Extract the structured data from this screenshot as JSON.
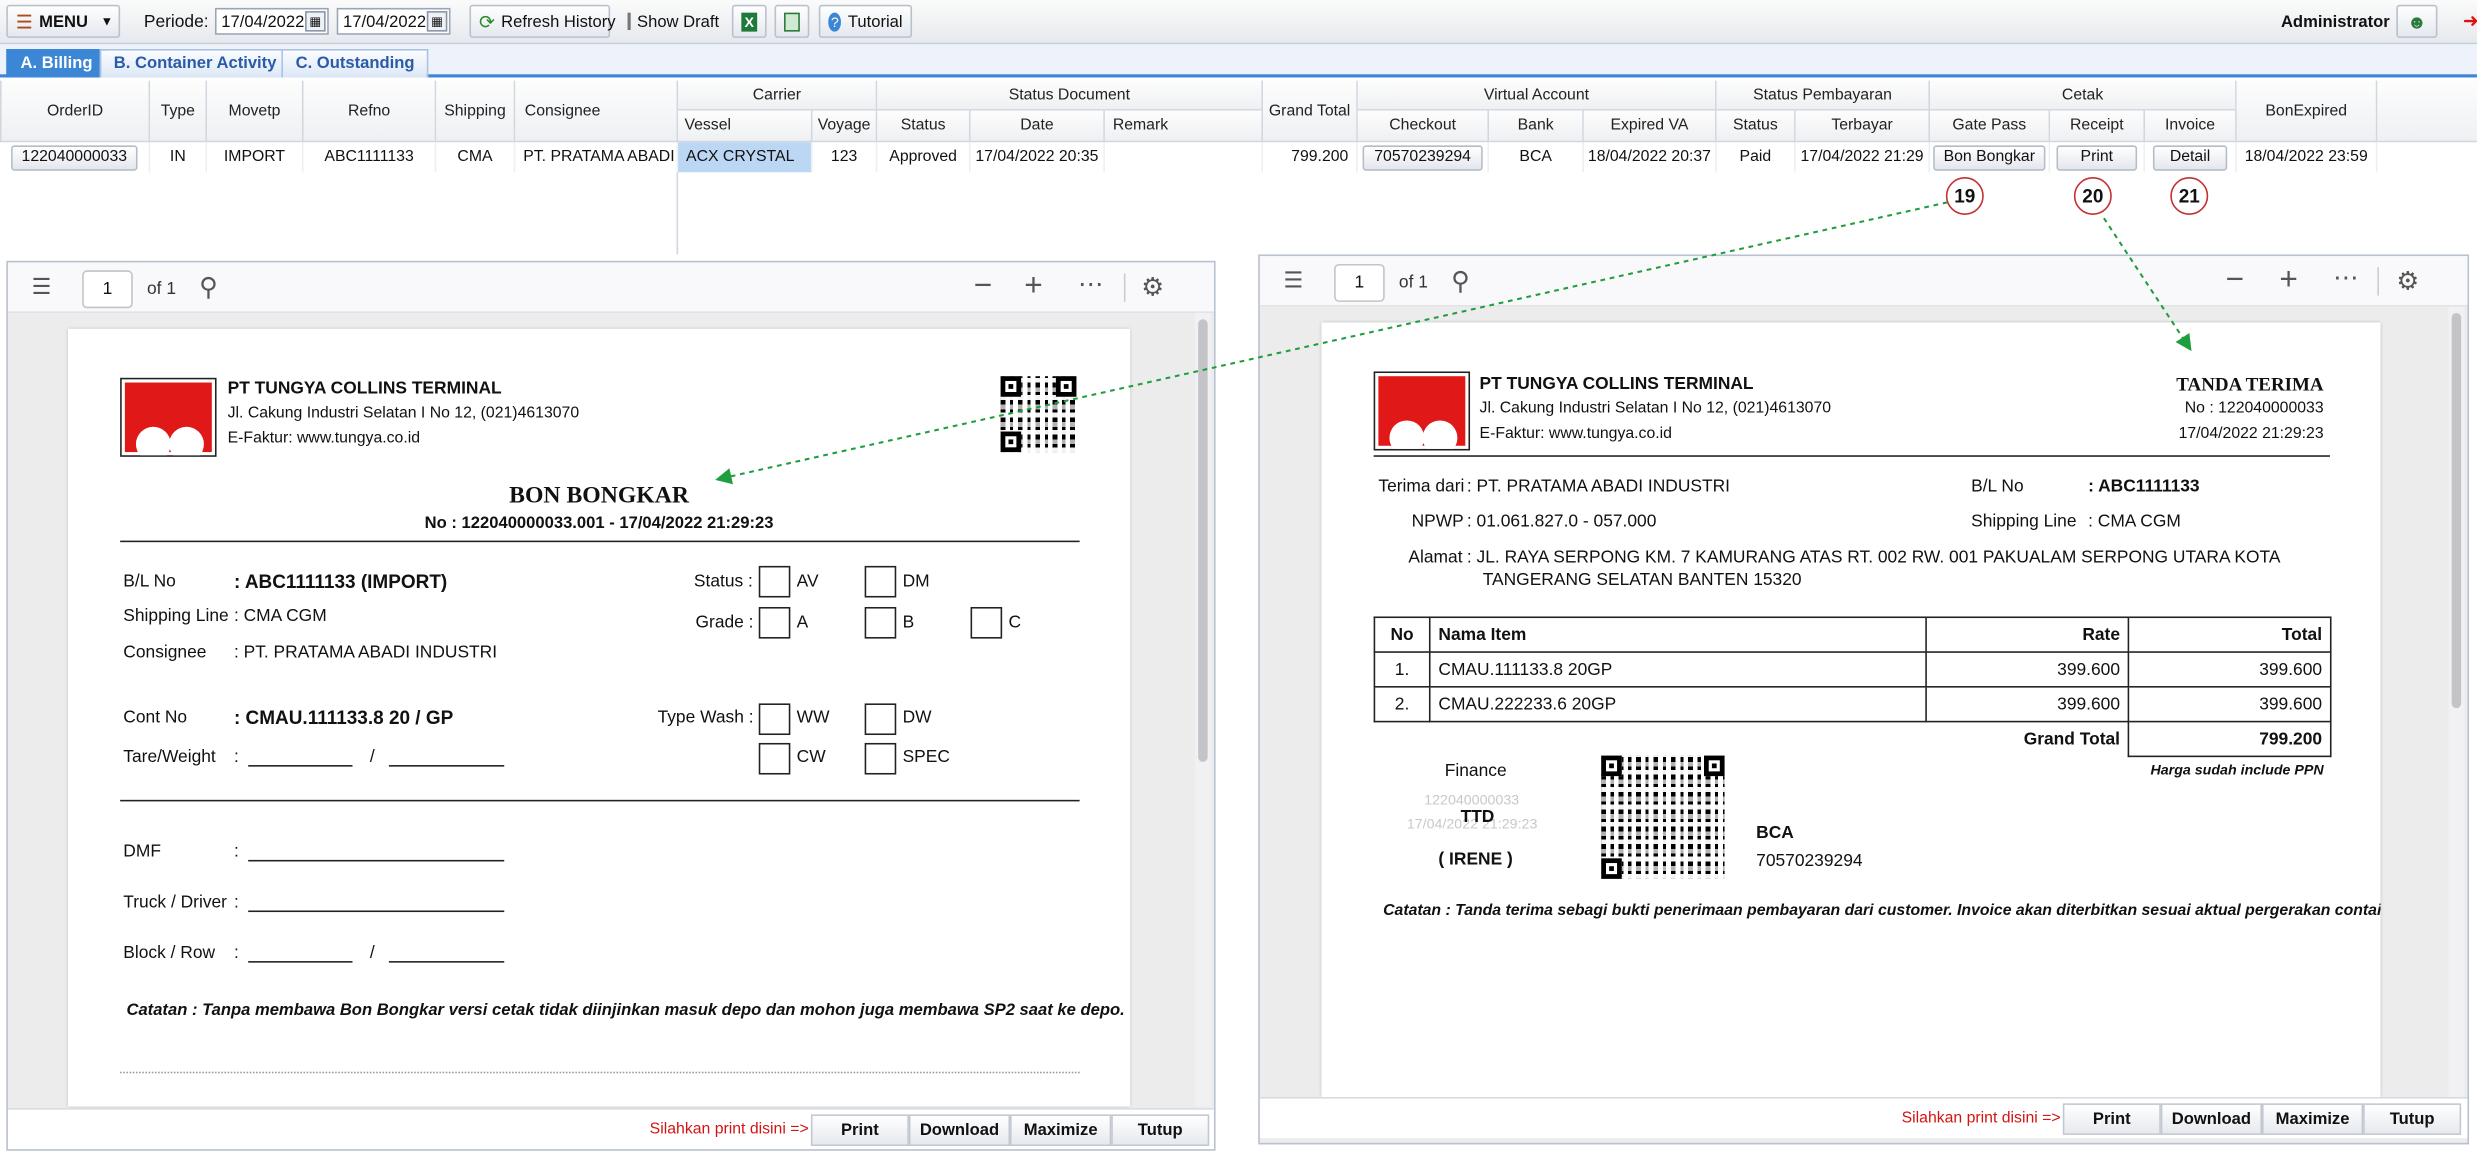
{
  "toolbar": {
    "menu": "MENU",
    "periode_label": "Periode:",
    "date_from": "17/04/2022",
    "date_to": "17/04/2022",
    "refresh": "Refresh History",
    "show_draft": "Show Draft",
    "tutorial": "Tutorial",
    "user": "Administrator"
  },
  "tabs": [
    "A. Billing",
    "B. Container Activity",
    "C. Outstanding"
  ],
  "grid": {
    "groups": {
      "carrier": "Carrier",
      "status_document": "Status Document",
      "virtual_account": "Virtual Account",
      "status_pembayaran": "Status Pembayaran",
      "cetak": "Cetak"
    },
    "cols": {
      "order_id": "OrderID",
      "type": "Type",
      "movetp": "Movetp",
      "refno": "Refno",
      "shipping": "Shipping",
      "consignee": "Consignee",
      "vessel": "Vessel",
      "voyage": "Voyage",
      "status": "Status",
      "date": "Date",
      "remark": "Remark",
      "grand_total": "Grand Total",
      "checkout": "Checkout",
      "bank": "Bank",
      "expired_va": "Expired VA",
      "pay_status": "Status",
      "terbayar": "Terbayar",
      "gate_pass": "Gate Pass",
      "receipt": "Receipt",
      "invoice": "Invoice",
      "bon_expired": "BonExpired"
    },
    "row": {
      "order_id": "122040000033",
      "type": "IN",
      "movetp": "IMPORT",
      "refno": "ABC1111133",
      "shipping": "CMA",
      "consignee": "PT. PRATAMA ABADI IN",
      "vessel": "ACX CRYSTAL",
      "voyage": "123",
      "status": "Approved",
      "date": "17/04/2022 20:35",
      "remark": "",
      "grand_total": "799.200",
      "checkout": "70570239294",
      "bank": "BCA",
      "expired_va": "18/04/2022 20:37",
      "pay_status": "Paid",
      "terbayar": "17/04/2022 21:29",
      "gate_pass": "Bon Bongkar",
      "receipt": "Print",
      "invoice": "Detail",
      "bon_expired": "18/04/2022 23:59"
    }
  },
  "callouts": [
    "19",
    "20",
    "21"
  ],
  "viewer_common": {
    "page": "1",
    "of": "of 1",
    "footer_hint": "Silahkan print disini =>",
    "btn_print": "Print",
    "btn_download": "Download",
    "btn_maximize": "Maximize",
    "btn_tutup": "Tutup"
  },
  "company": {
    "name": "PT TUNGYA COLLINS TERMINAL",
    "address": "Jl. Cakung Industri Selatan I No 12, (021)4613070",
    "faktur": "E-Faktur: www.tungya.co.id"
  },
  "bon": {
    "title": "BON BONGKAR",
    "number": "No : 122040000033.001  -  17/04/2022 21:29:23",
    "bl_label": "B/L No",
    "bl_value": ": ABC1111133 (IMPORT)",
    "shipping_label": "Shipping Line",
    "shipping_value": ": CMA CGM",
    "consignee_label": "Consignee",
    "consignee_value": ": PT. PRATAMA ABADI INDUSTRI",
    "status_label": "Status :",
    "av": "AV",
    "dm": "DM",
    "grade_label": "Grade :",
    "a": "A",
    "b": "B",
    "c": "C",
    "cont_label": "Cont No",
    "cont_value": ": CMAU.111133.8  20 / GP",
    "tare_label": "Tare/Weight",
    "colon": ":",
    "slash": "/",
    "wash_label": "Type Wash :",
    "ww": "WW",
    "dw": "DW",
    "cw": "CW",
    "spec": "SPEC",
    "dmf_label": "DMF",
    "truck_label": "Truck / Driver",
    "block_label": "Block / Row",
    "catatan": "Catatan : Tanpa membawa Bon Bongkar versi cetak tidak diinjinkan masuk depo dan mohon juga membawa SP2 saat ke depo."
  },
  "tanda": {
    "title": "TANDA TERIMA",
    "number": "No : 122040000033",
    "datetime": "17/04/2022 21:29:23",
    "terima_label": "Terima dari",
    "terima_value": ":  PT. PRATAMA ABADI INDUSTRI",
    "npwp_label": "NPWP",
    "npwp_value": ":  01.061.827.0 - 057.000",
    "alamat_label": "Alamat",
    "alamat_line1": ":  JL. RAYA SERPONG KM. 7 KAMURANG ATAS RT. 002 RW. 001 PAKUALAM SERPONG UTARA KOTA",
    "alamat_line2": "TANGERANG  SELATAN BANTEN 15320",
    "bl_label": "B/L No",
    "bl_value": ":  ABC1111133",
    "ship_label": "Shipping Line",
    "ship_value": ":  CMA CGM",
    "th_no": "No",
    "th_item": "Nama Item",
    "th_rate": "Rate",
    "th_total": "Total",
    "items": [
      {
        "no": "1.",
        "item": "CMAU.111133.8 20GP",
        "rate": "399.600",
        "total": "399.600"
      },
      {
        "no": "2.",
        "item": "CMAU.222233.6 20GP",
        "rate": "399.600",
        "total": "399.600"
      }
    ],
    "grand_label": "Grand Total",
    "grand_value": "799.200",
    "ppn": "Harga sudah include PPN",
    "finance": "Finance",
    "stamp_no": "122040000033",
    "stamp_date": "17/04/2022 21:29:23",
    "ttd": "TTD",
    "signer": "( IRENE )",
    "bank": "BCA",
    "va": "70570239294",
    "catatan": "Catatan : Tanda terima sebagi bukti penerimaan pembayaran dari customer. Invoice akan diterbitkan sesuai aktual pergerakan container"
  },
  "colors": {
    "accent": "#3c86d6",
    "logo_red": "#e01818",
    "callout": "#c43131",
    "arrow": "#1e9e3c",
    "hint": "#d21414"
  },
  "icons": [
    "menu-icon",
    "calendar-icon",
    "refresh-icon",
    "excel-icon",
    "export-icon",
    "tutorial-icon",
    "user-icon",
    "outline-icon",
    "search-icon",
    "zoom-out-icon",
    "zoom-in-icon",
    "more-icon",
    "settings-icon"
  ]
}
